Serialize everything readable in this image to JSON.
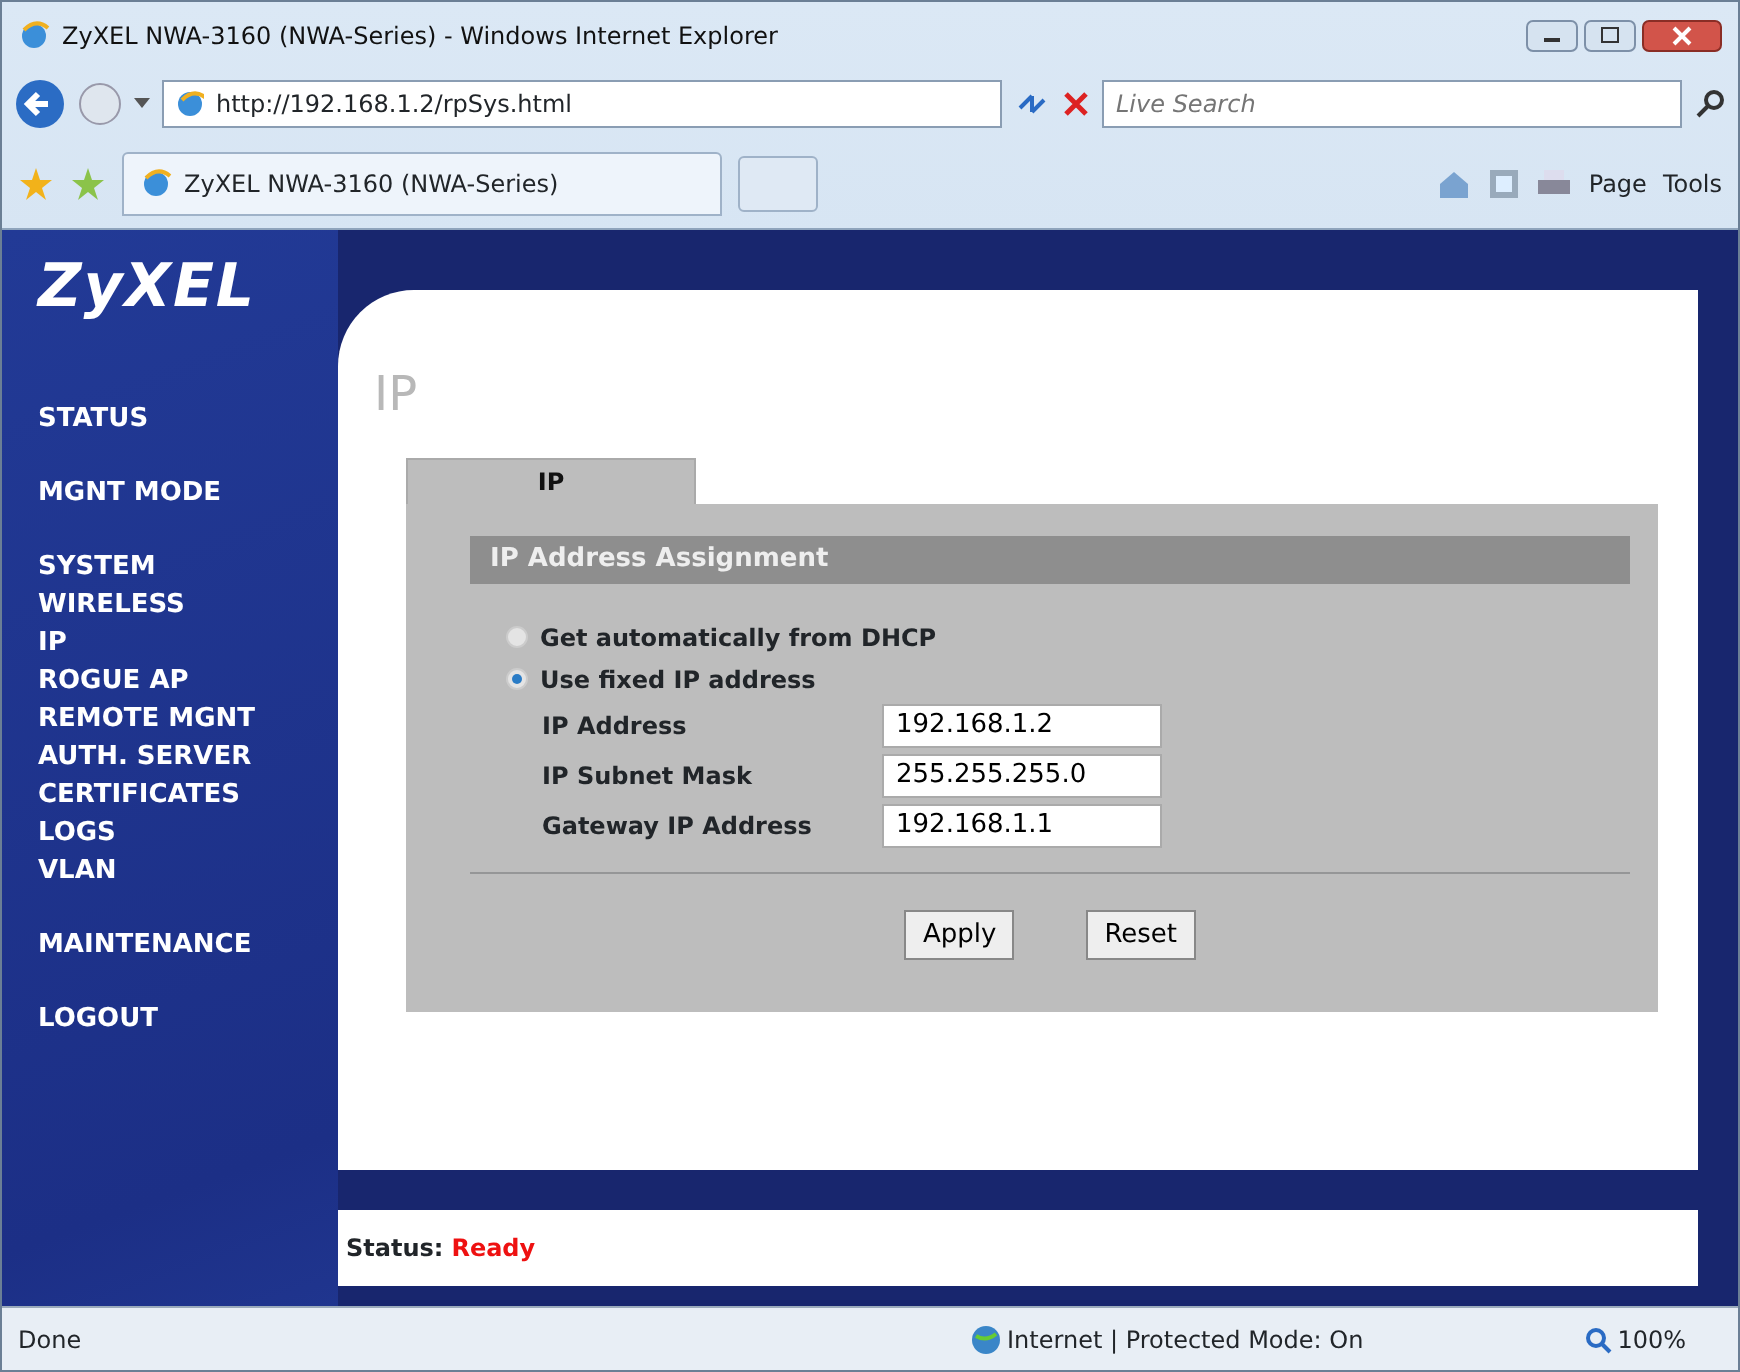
{
  "window": {
    "title": "ZyXEL NWA-3160 (NWA-Series) - Windows Internet Explorer"
  },
  "address_bar": {
    "url": "http://192.168.1.2/rpSys.html",
    "search": {
      "placeholder": "Live Search"
    }
  },
  "tab_bar": {
    "tab_title": "ZyXEL NWA-3160 (NWA-Series)",
    "commands": [
      "Page",
      "Tools"
    ]
  },
  "page": {
    "logo": "ZyXEL",
    "sidebar": {
      "groups": [
        {
          "items": [
            "STATUS"
          ]
        },
        {
          "items": [
            "MGNT MODE"
          ]
        },
        {
          "items": [
            "SYSTEM",
            "WIRELESS",
            "IP",
            "ROGUE AP",
            "REMOTE MGNT",
            "AUTH. SERVER",
            "CERTIFICATES",
            "LOGS",
            "VLAN"
          ]
        },
        {
          "items": [
            "MAINTENANCE"
          ]
        },
        {
          "items": [
            "LOGOUT"
          ]
        }
      ]
    },
    "title": "IP",
    "tabs": [
      {
        "label": "IP",
        "selected": true
      }
    ],
    "section": "IP Address Assignment",
    "radios": [
      {
        "label": "Get automatically from DHCP",
        "selected": false
      },
      {
        "label": "Use fixed IP address",
        "selected": true
      }
    ],
    "fields": [
      {
        "label": "IP Address",
        "value": "192.168.1.2"
      },
      {
        "label": "IP Subnet Mask",
        "value": "255.255.255.0"
      },
      {
        "label": "Gateway IP Address",
        "value": "192.168.1.1"
      }
    ],
    "buttons": [
      "Apply",
      "Reset"
    ],
    "status": {
      "label": "Status:",
      "value": "Ready"
    }
  },
  "status_bar": {
    "text": "Done",
    "zone": "Internet | Protected Mode: On",
    "zoom": "100%"
  }
}
